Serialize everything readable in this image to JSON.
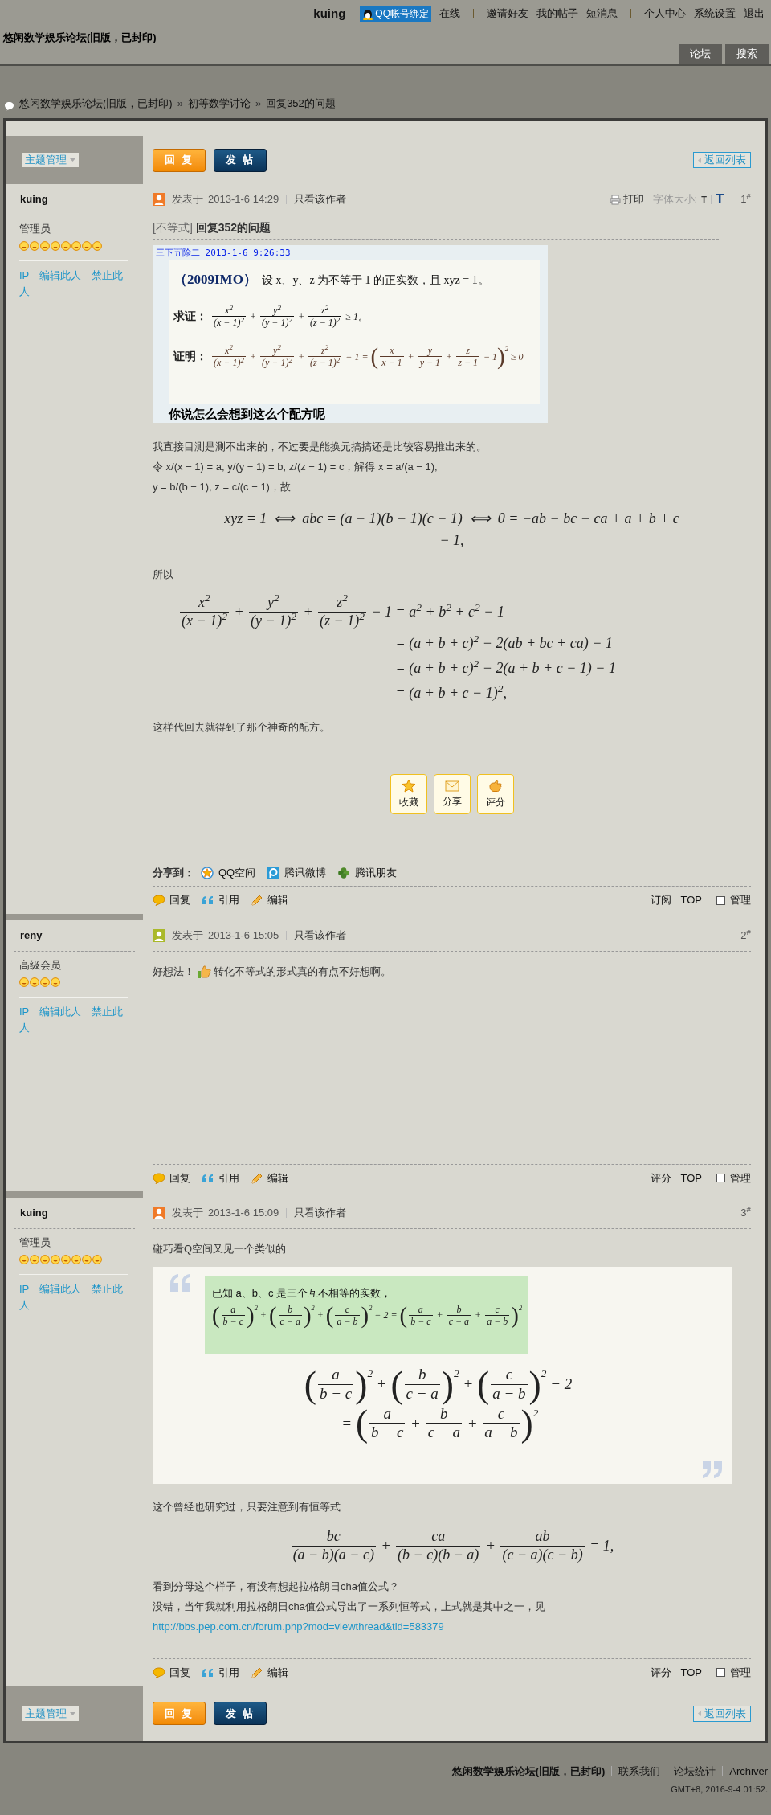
{
  "topbar": {
    "username": "kuing",
    "qq_bind": "QQ帐号绑定",
    "link_groups": [
      [
        "在线"
      ],
      [
        "邀请好友",
        "我的帖子",
        "短消息"
      ],
      [
        "个人中心",
        "系统设置",
        "退出"
      ]
    ]
  },
  "site_title": "悠闲数学娱乐论坛(旧版，已封印)",
  "nav_tabs": [
    "论坛",
    "搜索"
  ],
  "breadcrumb": {
    "separator": "»",
    "items": [
      "悠闲数学娱乐论坛(旧版，已封印)",
      "初等数学讨论",
      "回复352的问题"
    ]
  },
  "top_toolbar": {
    "manage": "主题管理",
    "reply": "回 复",
    "new_post": "发 帖",
    "back": "返回列表"
  },
  "posts": [
    {
      "author": "kuing",
      "author_online": true,
      "rank": "管理员",
      "rank_icons": [
        {
          "kind": "smiley"
        },
        {
          "kind": "smiley"
        },
        {
          "kind": "smiley"
        },
        {
          "kind": "smiley"
        },
        {
          "kind": "smiley"
        },
        {
          "kind": "smiley"
        },
        {
          "kind": "smiley"
        },
        {
          "kind": "smiley"
        }
      ],
      "user_links": [
        "IP",
        "编辑此人",
        "禁止此人"
      ],
      "posted_label": "发表于",
      "date": "2013-1-6 14:29",
      "only_author": "只看该作者",
      "tools": {
        "print": "打印",
        "font_size": "字体大小:",
        "small": "T",
        "large": "T"
      },
      "floor": "1",
      "floor_mark": "#",
      "title": {
        "tag": "[不等式]",
        "text": "回复352的问题"
      },
      "body": [
        {
          "kind": "chat_image",
          "sender": "三下五除二",
          "time": "2013-1-6 9:26:33",
          "source": "（2009IMO）",
          "statement": "设 x、y、z 为不等于 1 的正实数，且 xyz = 1。",
          "rows": [
            {
              "label": "求证：",
              "math": [
                {
                  "num": [
                    "x$^{2}$"
                  ],
                  "den": [
                    "(x − 1)$^{2}$"
                  ]
                },
                " + ",
                {
                  "num": [
                    "y$^{2}$"
                  ],
                  "den": [
                    "(y − 1)$^{2}$"
                  ]
                },
                " + ",
                {
                  "num": [
                    "z$^{2}$"
                  ],
                  "den": [
                    "(z − 1)$^{2}$"
                  ]
                },
                " ≥ 1。"
              ]
            },
            {
              "label": "证明：",
              "math": [
                {
                  "num": [
                    "x$^{2}$"
                  ],
                  "den": [
                    "(x − 1)$^{2}$"
                  ]
                },
                " + ",
                {
                  "num": [
                    "y$^{2}$"
                  ],
                  "den": [
                    "(y − 1)$^{2}$"
                  ]
                },
                " + ",
                {
                  "num": [
                    "z$^{2}$"
                  ],
                  "den": [
                    "(z − 1)$^{2}$"
                  ]
                },
                " − 1 = ",
                {
                  "open": "(",
                  "close": ")",
                  "inner": [
                    {
                      "num": [
                        "x"
                      ],
                      "den": [
                        "x − 1"
                      ]
                    },
                    " + ",
                    {
                      "num": [
                        "y"
                      ],
                      "den": [
                        "y − 1"
                      ]
                    },
                    " + ",
                    {
                      "num": [
                        "z"
                      ],
                      "den": [
                        "z − 1"
                      ]
                    },
                    " − 1"
                  ],
                  "sup": "2"
                },
                " ≥ 0"
              ]
            }
          ],
          "caption": "你说怎么会想到这么个配方呢"
        },
        {
          "kind": "para",
          "lines": [
            "我直接目测是测不出来的，不过要是能换元搞搞还是比较容易推出来的。",
            "令 x/(x − 1) = a, y/(y − 1) = b, z/(z − 1) = c，解得 x = a/(a − 1),",
            "y = b/(b − 1), z = c/(c − 1)，故"
          ]
        },
        {
          "kind": "math",
          "rows": [
            [
              "xyz = 1  ⟺  abc = (a − 1)(b − 1)(c − 1)  ⟺  0 = −ab − bc − ca + a + b + c"
            ],
            [
              "− 1,"
            ]
          ]
        },
        {
          "kind": "para",
          "lines": [
            "所以"
          ]
        },
        {
          "kind": "aligned_math",
          "rows": [
            {
              "left": [
                {
                  "num": [
                    "x$^{2}$"
                  ],
                  "den": [
                    "(x − 1)$^{2}$"
                  ]
                },
                " + ",
                {
                  "num": [
                    "y$^{2}$"
                  ],
                  "den": [
                    "(y − 1)$^{2}$"
                  ]
                },
                " + ",
                {
                  "num": [
                    "z$^{2}$"
                  ],
                  "den": [
                    "(z − 1)$^{2}$"
                  ]
                },
                " − 1"
              ],
              "right": [
                " = a$^{2}$ + b$^{2}$ + c$^{2}$ − 1"
              ]
            },
            {
              "right": [
                " = (a + b + c)$^{2}$ − 2(ab + bc + ca) − 1"
              ]
            },
            {
              "right": [
                " = (a + b + c)$^{2}$ − 2(a + b + c − 1) − 1"
              ]
            },
            {
              "right": [
                " = (a + b + c − 1)$^{2}$,"
              ]
            }
          ]
        },
        {
          "kind": "para",
          "lines": [
            "这样代回去就得到了那个神奇的配方。"
          ]
        }
      ],
      "post_buttons": [
        "收藏",
        "分享",
        "评分"
      ],
      "share": {
        "label": "分享到：",
        "targets": [
          "QQ空间",
          "腾讯微博",
          "腾讯朋友"
        ]
      },
      "actions": [
        "回复",
        "引用",
        "编辑"
      ],
      "right_links": [
        "订阅",
        "TOP"
      ],
      "manage": {
        "label": "管理",
        "checked": false
      }
    },
    {
      "author": "reny",
      "author_online": false,
      "rank": "高级会员",
      "rank_icons": [
        {
          "kind": "smiley"
        },
        {
          "kind": "smiley"
        },
        {
          "kind": "smiley"
        },
        {
          "kind": "smiley"
        }
      ],
      "user_links": [
        "IP",
        "编辑此人",
        "禁止此人"
      ],
      "posted_label": "发表于",
      "date": "2013-1-6 15:05",
      "only_author": "只看该作者",
      "floor": "2",
      "floor_mark": "#",
      "body": [
        {
          "kind": "emote_para",
          "parts": [
            "好想法！",
            "转化不等式的形式真的有点不好想啊。"
          ]
        }
      ],
      "actions": [
        "回复",
        "引用",
        "编辑"
      ],
      "right_links": [
        "评分",
        "TOP"
      ],
      "manage": {
        "label": "管理",
        "checked": false
      }
    },
    {
      "author": "kuing",
      "author_online": true,
      "rank": "管理员",
      "rank_icons": [
        {
          "kind": "smiley"
        },
        {
          "kind": "smiley"
        },
        {
          "kind": "smiley"
        },
        {
          "kind": "smiley"
        },
        {
          "kind": "smiley"
        },
        {
          "kind": "smiley"
        },
        {
          "kind": "smiley"
        },
        {
          "kind": "smiley"
        }
      ],
      "user_links": [
        "IP",
        "编辑此人",
        "禁止此人"
      ],
      "posted_label": "发表于",
      "date": "2013-1-6 15:09",
      "only_author": "只看该作者",
      "floor": "3",
      "floor_mark": "#",
      "body": [
        {
          "kind": "para",
          "lines": [
            "碰巧看Q空间又见一个类似的"
          ]
        },
        {
          "kind": "quote",
          "image": {
            "intro": "已知 a、b、c 是三个互不相等的实数，",
            "math": [
              {
                "open": "(",
                "close": ")",
                "inner": [
                  {
                    "num": [
                      "a"
                    ],
                    "den": [
                      "b − c"
                    ]
                  }
                ],
                "sup": "2"
              },
              " + ",
              {
                "open": "(",
                "close": ")",
                "inner": [
                  {
                    "num": [
                      "b"
                    ],
                    "den": [
                      "c − a"
                    ]
                  }
                ],
                "sup": "2"
              },
              " + ",
              {
                "open": "(",
                "close": ")",
                "inner": [
                  {
                    "num": [
                      "c"
                    ],
                    "den": [
                      "a − b"
                    ]
                  }
                ],
                "sup": "2"
              },
              " − 2 = ",
              {
                "open": "(",
                "close": ")",
                "inner": [
                  {
                    "num": [
                      "a"
                    ],
                    "den": [
                      "b − c"
                    ]
                  },
                  " + ",
                  {
                    "num": [
                      "b"
                    ],
                    "den": [
                      "c − a"
                    ]
                  },
                  " + ",
                  {
                    "num": [
                      "c"
                    ],
                    "den": [
                      "a − b"
                    ]
                  }
                ],
                "sup": "2"
              }
            ]
          },
          "rows": [
            [
              {
                "open": "(",
                "close": ")",
                "inner": [
                  {
                    "num": [
                      "a"
                    ],
                    "den": [
                      "b − c"
                    ]
                  }
                ],
                "sup": "2"
              },
              " + ",
              {
                "open": "(",
                "close": ")",
                "inner": [
                  {
                    "num": [
                      "b"
                    ],
                    "den": [
                      "c − a"
                    ]
                  }
                ],
                "sup": "2"
              },
              " + ",
              {
                "open": "(",
                "close": ")",
                "inner": [
                  {
                    "num": [
                      "c"
                    ],
                    "den": [
                      "a − b"
                    ]
                  }
                ],
                "sup": "2"
              },
              " − 2"
            ],
            [
              " = ",
              {
                "open": "(",
                "close": ")",
                "inner": [
                  {
                    "num": [
                      "a"
                    ],
                    "den": [
                      "b − c"
                    ]
                  },
                  " + ",
                  {
                    "num": [
                      "b"
                    ],
                    "den": [
                      "c − a"
                    ]
                  },
                  " + ",
                  {
                    "num": [
                      "c"
                    ],
                    "den": [
                      "a − b"
                    ]
                  }
                ],
                "sup": "2"
              }
            ]
          ]
        },
        {
          "kind": "para",
          "lines": [
            "这个曾经也研究过，只要注意到有恒等式"
          ]
        },
        {
          "kind": "math",
          "rows": [
            [
              {
                "num": [
                  "bc"
                ],
                "den": [
                  "(a − b)(a − c)"
                ]
              },
              " + ",
              {
                "num": [
                  "ca"
                ],
                "den": [
                  "(b − c)(b − a)"
                ]
              },
              " + ",
              {
                "num": [
                  "ab"
                ],
                "den": [
                  "(c − a)(c − b)"
                ]
              },
              " = 1,"
            ]
          ]
        },
        {
          "kind": "para",
          "lines": [
            "看到分母这个样子，有没有想起拉格朗日cha值公式？",
            "没错，当年我就利用拉格朗日cha值公式导出了一系列恒等式，上式就是其中之一，见"
          ],
          "link": "http://bbs.pep.com.cn/forum.php?mod=viewthread&tid=583379"
        }
      ],
      "actions": [
        "回复",
        "引用",
        "编辑"
      ],
      "right_links": [
        "评分",
        "TOP"
      ],
      "manage": {
        "label": "管理",
        "checked": false
      }
    }
  ],
  "bottom_toolbar": {
    "manage": "主题管理",
    "reply": "回 复",
    "new_post": "发 帖",
    "back": "返回列表"
  },
  "footer": {
    "site": "悠闲数学娱乐论坛(旧版，已封印)",
    "links": [
      "联系我们",
      "论坛统计",
      "Archiver"
    ],
    "time": "GMT+8, 2016-9-4 01:52."
  }
}
